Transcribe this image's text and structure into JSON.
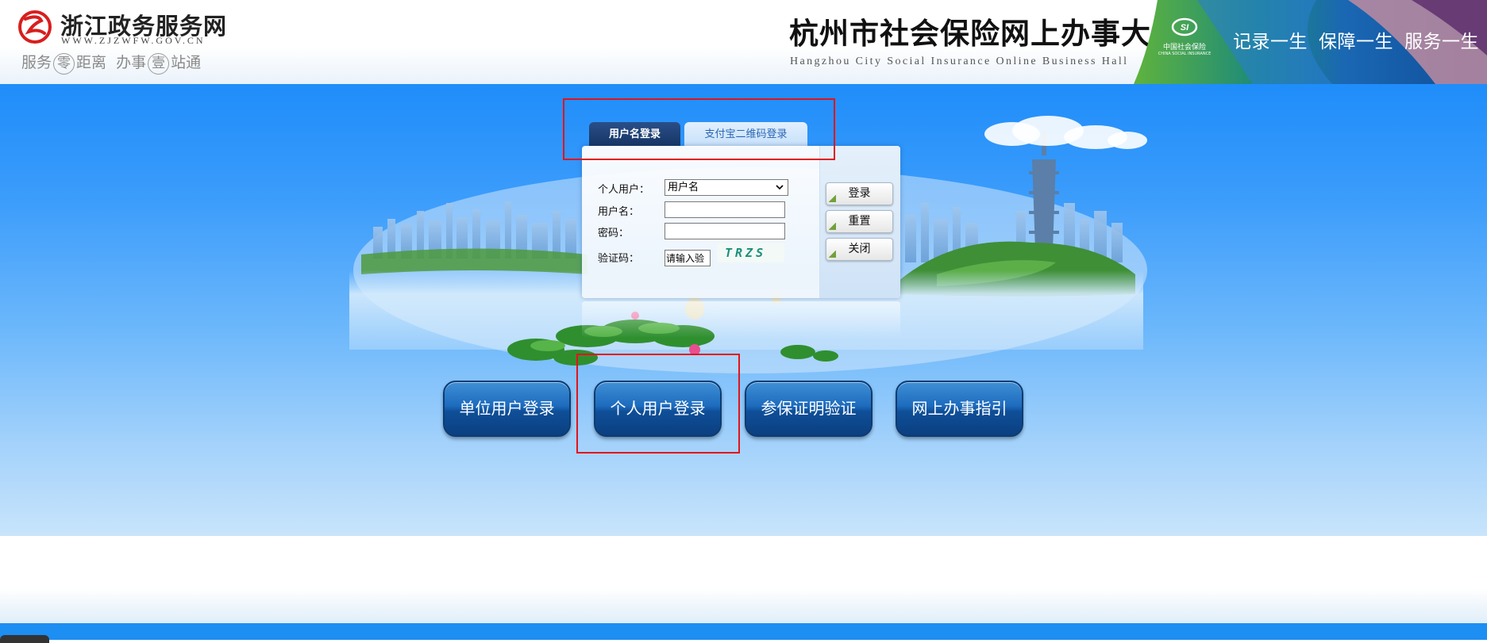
{
  "header": {
    "portal_title": "浙江政务服务网",
    "portal_url": "WWW.ZJZWFW.GOV.CN",
    "slogan": {
      "part1": "服务",
      "circle1": "零",
      "part2": "距离",
      "part3": "办事",
      "circle2": "壹",
      "part4": "站通"
    },
    "hall_title": "杭州市社会保险网上办事大厅",
    "hall_subtitle": "Hangzhou City Social Insurance Online Business Hall",
    "si_logo": {
      "mark": "SI",
      "cn": "中国社会保险",
      "en": "CHINA SOCIAL INSURANCE"
    },
    "motto": [
      "记录一生",
      "保障一生",
      "服务一生"
    ]
  },
  "login": {
    "tabs": [
      {
        "label": "用户名登录",
        "active": true
      },
      {
        "label": "支付宝二维码登录",
        "active": false
      }
    ],
    "user_type_label": "个人用户：",
    "user_type_value": "用户名",
    "username_label": "用户名：",
    "username_value": "",
    "password_label": "密码：",
    "password_value": "",
    "captcha_label": "验证码：",
    "captcha_input_value": "请输入验",
    "captcha_text": "TRZS",
    "buttons": {
      "login": "登录",
      "reset": "重置",
      "close": "关闭"
    }
  },
  "nav_buttons": [
    "单位用户登录",
    "个人用户登录",
    "参保证明验证",
    "网上办事指引"
  ],
  "colors": {
    "header_blue": "#1f8dfa",
    "button_blue": "#1d6bbd",
    "highlight_red": "#e3131b"
  }
}
